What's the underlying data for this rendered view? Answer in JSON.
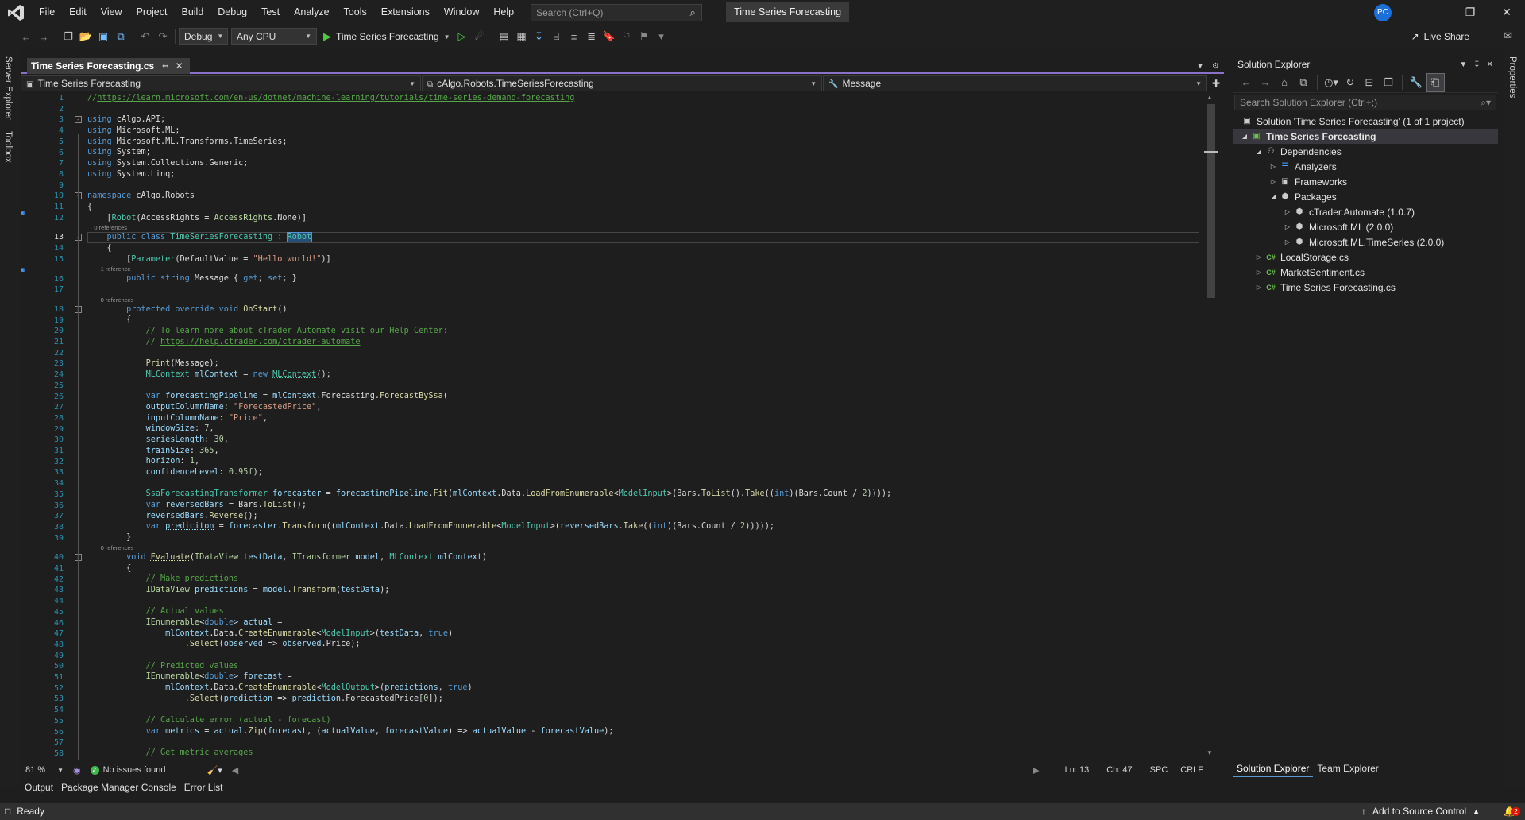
{
  "menubar": {
    "items": [
      "File",
      "Edit",
      "View",
      "Project",
      "Build",
      "Debug",
      "Test",
      "Analyze",
      "Tools",
      "Extensions",
      "Window",
      "Help"
    ],
    "search_placeholder": "Search (Ctrl+Q)",
    "solution_title": "Time Series Forecasting",
    "avatar_initials": "PC"
  },
  "toolbar": {
    "config": "Debug",
    "platform": "Any CPU",
    "run_target": "Time Series Forecasting",
    "live_share": "Live Share"
  },
  "side_tabs": {
    "server_explorer": "Server Explorer",
    "toolbox": "Toolbox",
    "properties": "Properties"
  },
  "editor": {
    "tab_title": "Time Series Forecasting.cs",
    "nav_project": "Time Series Forecasting",
    "nav_class": "cAlgo.Robots.TimeSeriesForecasting",
    "nav_member": "Message",
    "zoom": "81 %",
    "issues": "No issues found",
    "ln": "Ln: 13",
    "ch": "Ch: 47",
    "ws": "SPC",
    "eol": "CRLF",
    "line_numbers": [
      1,
      2,
      3,
      4,
      5,
      6,
      7,
      8,
      9,
      10,
      11,
      12,
      13,
      14,
      15,
      16,
      17,
      18,
      19,
      20,
      21,
      22,
      23,
      24,
      25,
      26,
      27,
      28,
      29,
      30,
      31,
      32,
      33,
      34,
      35,
      36,
      37,
      38,
      39,
      40,
      41,
      42,
      43,
      44,
      45,
      46,
      47,
      48,
      49,
      50,
      51,
      52,
      53,
      54,
      55,
      56,
      57,
      58
    ],
    "code_lens": {
      "l13": "0 references",
      "l16": "1 reference",
      "l18": "0 references",
      "l40": "0 references"
    },
    "code": {
      "l1_url": "https://learn.microsoft.com/en-us/dotnet/machine-learning/tutorials/time-series-demand-forecasting",
      "l20": "// To learn more about cTrader Automate visit our Help Center:",
      "l21_url": "https://help.ctrader.com/ctrader-automate",
      "l15_str": "\"Hello world!\"",
      "l27_str": "\"ForecastedPrice\"",
      "l28_str": "\"Price\"",
      "l42": "// Make predictions",
      "l45": "// Actual values",
      "l50": "// Predicted values",
      "l55": "// Calculate error (actual - forecast)",
      "l58": "// Get metric averages"
    }
  },
  "bottom_tabs": [
    "Output",
    "Package Manager Console",
    "Error List"
  ],
  "solution_explorer": {
    "title": "Solution Explorer",
    "search_placeholder": "Search Solution Explorer (Ctrl+;)",
    "solution": "Solution 'Time Series Forecasting' (1 of 1 project)",
    "project": "Time Series Forecasting",
    "dependencies": "Dependencies",
    "analyzers": "Analyzers",
    "frameworks": "Frameworks",
    "packages": "Packages",
    "pkg1": "cTrader.Automate (1.0.7)",
    "pkg2": "Microsoft.ML (2.0.0)",
    "pkg3": "Microsoft.ML.TimeSeries (2.0.0)",
    "file1": "LocalStorage.cs",
    "file2": "MarketSentiment.cs",
    "file3": "Time Series Forecasting.cs",
    "tabs": [
      "Solution Explorer",
      "Team Explorer"
    ]
  },
  "statusbar": {
    "ready": "Ready",
    "source_control": "Add to Source Control",
    "notifications": "2"
  },
  "colors": {
    "accent": "#8a72c9",
    "keyword": "#569cd6",
    "type": "#4ec9b0",
    "comment": "#57a64a",
    "string": "#d69d85",
    "statusbar": "#303030"
  }
}
